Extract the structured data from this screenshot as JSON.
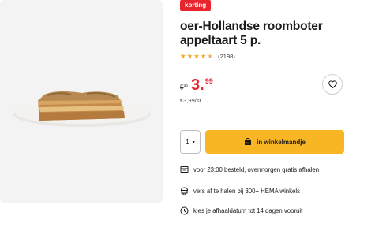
{
  "product": {
    "badge": "korting",
    "title": "oer-Hollandse roomboter appeltaart 5 p.",
    "image_icon": "appeltaart-product-photo",
    "rating": {
      "value": 4.5,
      "max": 5,
      "count_label": "(2198)"
    },
    "price": {
      "old_int": "5",
      "old_dec": "95",
      "new_int": "3.",
      "new_dec": "99",
      "unit_price": "€3,99/st."
    }
  },
  "actions": {
    "favorite_icon": "heart-icon",
    "quantity": "1",
    "cart_label": "in winkelmandje",
    "cart_icon": "shopping-bag-icon"
  },
  "usps": [
    {
      "icon": "delivery-truck-icon",
      "text": "voor 23:00 besteld, overmorgen gratis afhalen"
    },
    {
      "icon": "store-pickup-icon",
      "text": "vers af te halen bij 300+ HEMA winkels"
    },
    {
      "icon": "clock-icon",
      "text": "kies je afhaaldatum tot 14 dagen vooruit"
    }
  ],
  "colors": {
    "accent_red": "#e8252c",
    "cart_yellow": "#f8b624",
    "star_gold": "#f5a623",
    "image_bg": "#f3f3f3"
  }
}
